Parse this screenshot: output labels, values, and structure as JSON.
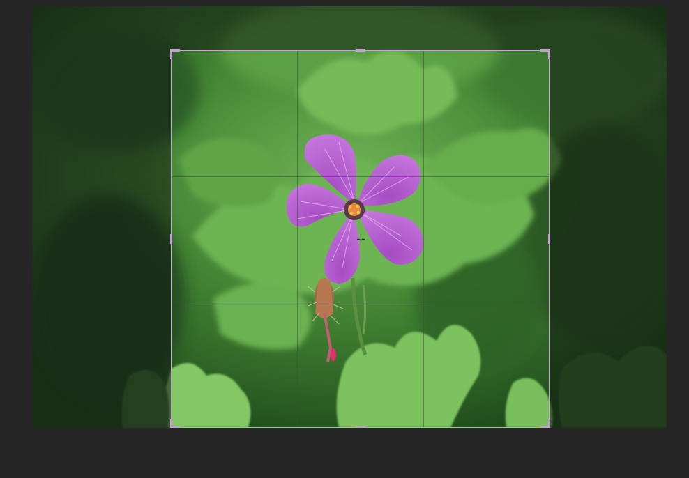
{
  "editor": {
    "mode": "crop",
    "background_color": "#262626"
  },
  "photo": {
    "subject": "pink-geranium-flower",
    "petal_color": "#b75ad0",
    "leaf_color": "#5aa63e",
    "bud_color": "#d8487a"
  },
  "crop": {
    "border_color": "#c9a6d6",
    "handle_color": "#c79bd8",
    "grid": "rule-of-thirds",
    "shade_opacity": 0.55
  },
  "icons": {
    "corner_handles": "crop-corner-handle-icon",
    "edge_handles": "crop-edge-handle-icon",
    "center": "crosshair-icon"
  }
}
